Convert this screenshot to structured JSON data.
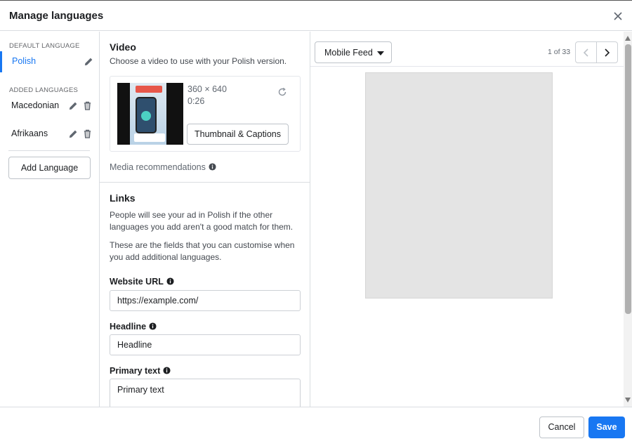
{
  "dialog": {
    "title": "Manage languages",
    "close_icon": "close-icon"
  },
  "languages": {
    "default_label": "DEFAULT LANGUAGE",
    "default_name": "Polish",
    "added_label": "ADDED LANGUAGES",
    "added": [
      {
        "name": "Macedonian"
      },
      {
        "name": "Afrikaans"
      }
    ],
    "add_button": "Add Language"
  },
  "video": {
    "heading": "Video",
    "description": "Choose a video to use with your Polish version.",
    "dimensions": "360 × 640",
    "duration": "0:26",
    "thumbnail_button": "Thumbnail & Captions",
    "media_recommendations": "Media recommendations"
  },
  "links": {
    "heading": "Links",
    "para1": "People will see your ad in Polish if the other languages you add aren't a good match for them.",
    "para2": "These are the fields that you can customise when you add additional languages.",
    "website_url_label": "Website URL",
    "website_url_value": "https://example.com/",
    "headline_label": "Headline",
    "headline_value": "Headline",
    "primary_text_label": "Primary text",
    "primary_text_value": "Primary text"
  },
  "preview": {
    "placement": "Mobile Feed",
    "pager": "1 of 33"
  },
  "footer": {
    "cancel": "Cancel",
    "save": "Save"
  },
  "colors": {
    "accent": "#1877f2",
    "border": "#dadde1"
  }
}
